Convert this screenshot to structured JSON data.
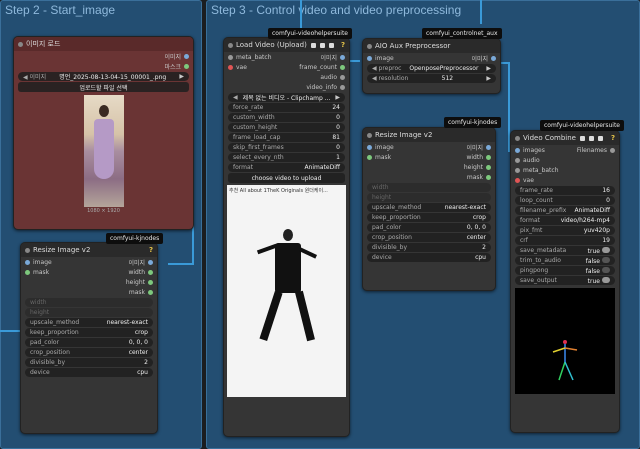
{
  "groups": [
    {
      "title": "Step 2 - Start_image"
    },
    {
      "title": "Step 3 - Control video and video preprocessing"
    }
  ],
  "badges": {
    "vhs1": "comfyui-videohelpersuite",
    "ctrl": "comfyui_controlnet_aux",
    "kj1": "comfyui-kjnodes",
    "kj2": "comfyui-kjnodes",
    "vhs2": "comfyui-videohelpersuite"
  },
  "load_image": {
    "title": "이미지 로드",
    "outputs": [
      "이미지",
      "마스크"
    ],
    "image_label": "이미지",
    "image_value": "명언_2025-08-13-04-15_00001_.png",
    "upload": "업로드할 파일 선택",
    "dims": "1080 × 1920"
  },
  "load_video": {
    "title": "Load Video (Upload)",
    "inputs": [
      "meta_batch",
      "vae"
    ],
    "outputs": [
      "이미지",
      "frame_count",
      "audio",
      "video_info"
    ],
    "widgets": [
      {
        "k": "",
        "v": "제목 없는 비디오 - Clipchamp ..."
      },
      {
        "k": "force_rate",
        "v": "24"
      },
      {
        "k": "custom_width",
        "v": "0"
      },
      {
        "k": "custom_height",
        "v": "0"
      },
      {
        "k": "frame_load_cap",
        "v": "81"
      },
      {
        "k": "skip_first_frames",
        "v": "0"
      },
      {
        "k": "select_every_nth",
        "v": "1"
      },
      {
        "k": "format",
        "v": "AnimateDiff"
      }
    ],
    "button": "choose video to upload",
    "preview_caption": "추천 All about 1TheK Originals 원더케이..."
  },
  "aio": {
    "title": "AIO Aux Preprocessor",
    "input": "image",
    "output": "이미지",
    "widgets": [
      {
        "k": "preproc",
        "v": "OpenposePreprocessor"
      },
      {
        "k": "resolution",
        "v": "512"
      }
    ]
  },
  "resize1": {
    "title": "Resize Image v2",
    "inputs": [
      "image",
      "mask"
    ],
    "outputs": [
      "이미지",
      "width",
      "height",
      "mask"
    ],
    "disabled": [
      "width",
      "height"
    ],
    "widgets": [
      {
        "k": "upscale_method",
        "v": "nearest-exact"
      },
      {
        "k": "keep_proportion",
        "v": "crop"
      },
      {
        "k": "pad_color",
        "v": "0, 0, 0"
      },
      {
        "k": "crop_position",
        "v": "center"
      },
      {
        "k": "divisible_by",
        "v": "2"
      },
      {
        "k": "device",
        "v": "cpu"
      }
    ]
  },
  "resize2": {
    "title": "Resize Image v2",
    "inputs": [
      "image",
      "mask"
    ],
    "outputs": [
      "이미지",
      "width",
      "height",
      "mask"
    ],
    "disabled": [
      "width",
      "height"
    ],
    "widgets": [
      {
        "k": "upscale_method",
        "v": "nearest-exact"
      },
      {
        "k": "keep_proportion",
        "v": "crop"
      },
      {
        "k": "pad_color",
        "v": "0, 0, 0"
      },
      {
        "k": "crop_position",
        "v": "center"
      },
      {
        "k": "divisible_by",
        "v": "2"
      },
      {
        "k": "device",
        "v": "cpu"
      }
    ]
  },
  "combine": {
    "title": "Video Combine",
    "inputs": [
      "images",
      "audio",
      "meta_batch",
      "vae"
    ],
    "output": "Filenames",
    "widgets": [
      {
        "k": "frame_rate",
        "v": "16"
      },
      {
        "k": "loop_count",
        "v": "0"
      },
      {
        "k": "filename_prefix",
        "v": "AnimateDiff"
      },
      {
        "k": "format",
        "v": "video/h264-mp4"
      },
      {
        "k": "pix_fmt",
        "v": "yuv420p"
      },
      {
        "k": "crf",
        "v": "19"
      },
      {
        "k": "save_metadata",
        "v": "true"
      },
      {
        "k": "trim_to_audio",
        "v": "false"
      },
      {
        "k": "pingpong",
        "v": "false"
      },
      {
        "k": "save_output",
        "v": "true"
      }
    ]
  }
}
